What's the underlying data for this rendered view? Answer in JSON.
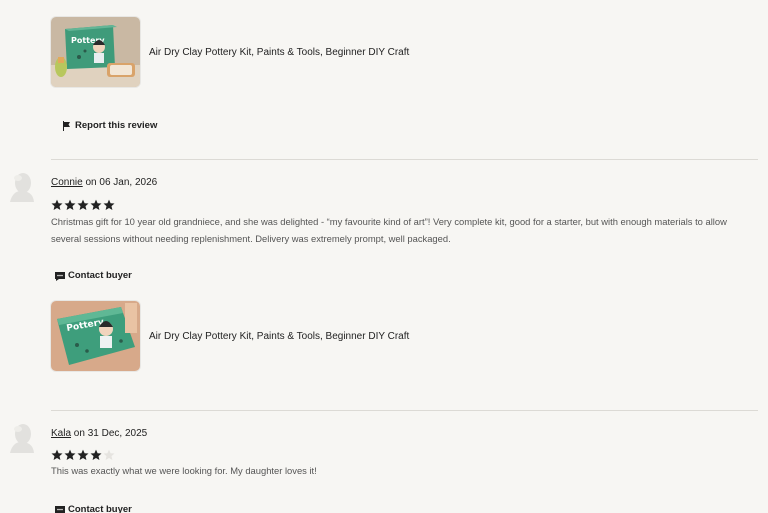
{
  "product_title": "Air Dry Clay Pottery Kit, Paints & Tools, Beginner DIY Craft",
  "report_link": "Report this review",
  "contact_link": "Contact buyer",
  "reviews": [
    {
      "name": "Connie",
      "date": "on 06 Jan, 2026",
      "rating": 5,
      "text": "Christmas gift for 10 year old grandniece, and she was delighted - “my favourite kind of art”! Very complete kit, good for a starter, but with enough materials to allow several sessions without needing replenishment. Delivery was extremely prompt, well packaged."
    },
    {
      "name": "Kala",
      "date": "on 31 Dec, 2025",
      "rating": 4,
      "text": "This was exactly what we were looking for. My daughter loves it!"
    }
  ],
  "colors": {
    "star_filled": "#222222",
    "star_empty": "#e6e4e0",
    "box_green": "#3e9e7c"
  }
}
